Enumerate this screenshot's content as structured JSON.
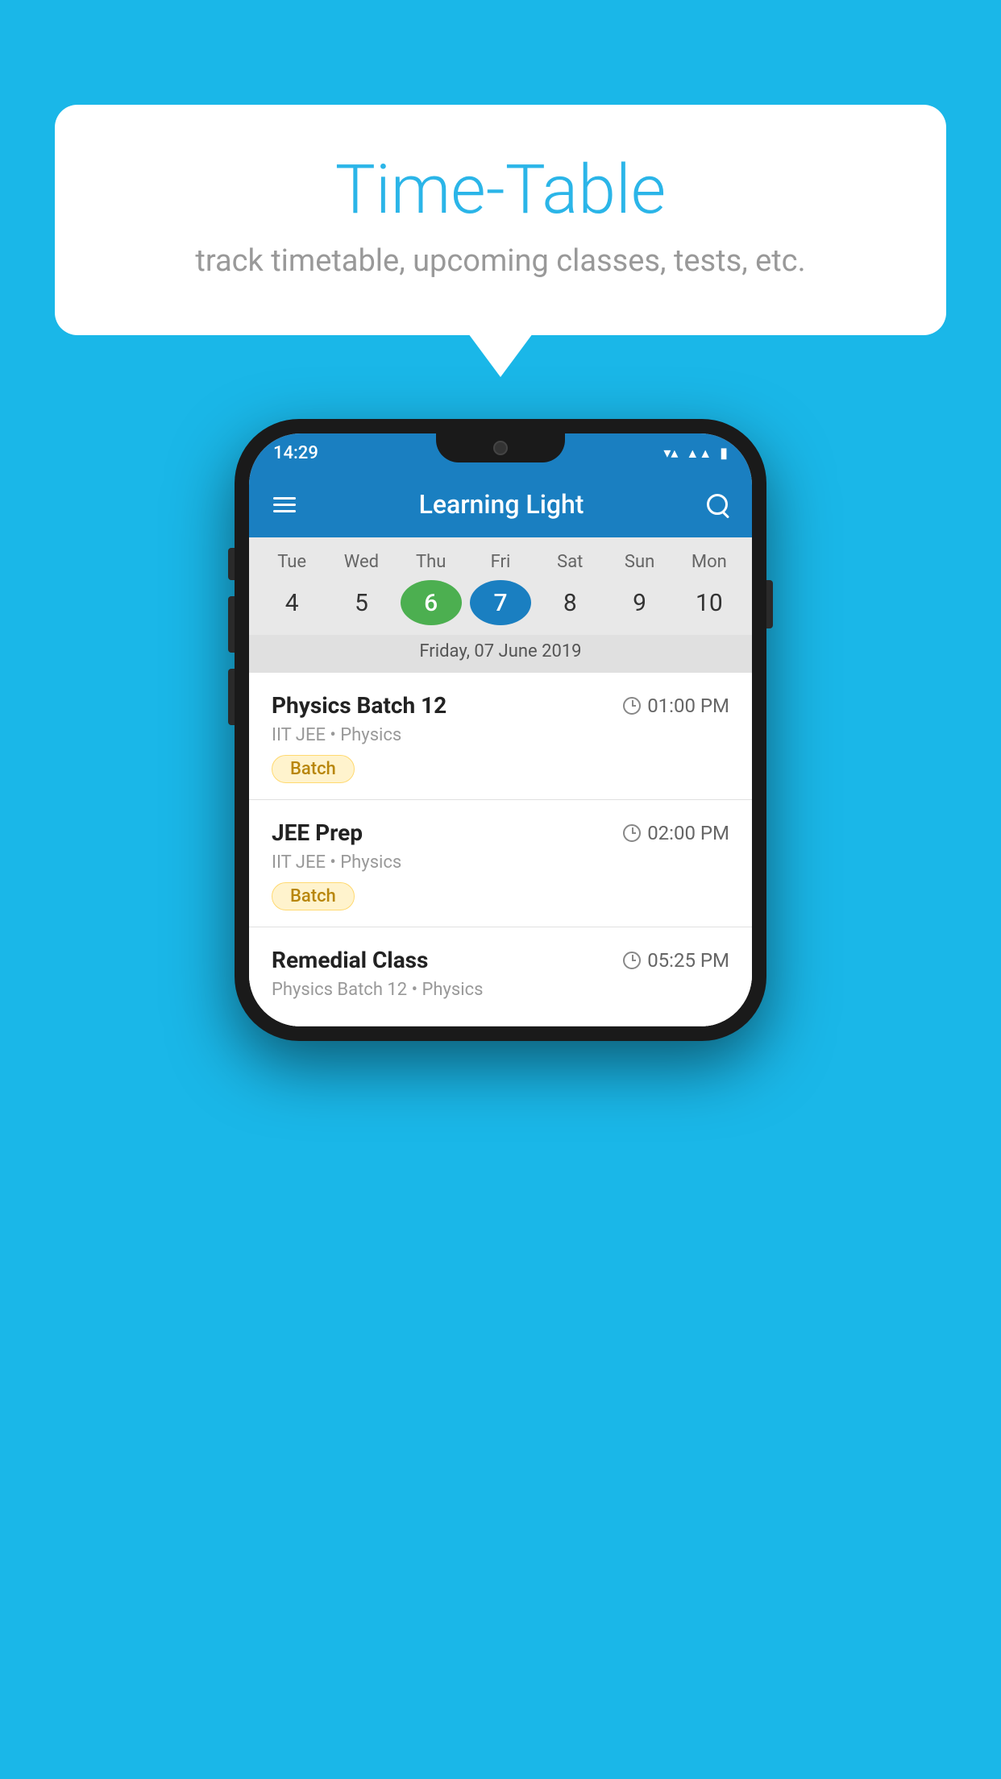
{
  "background_color": "#1ab7e8",
  "bubble": {
    "title": "Time-Table",
    "subtitle": "track timetable, upcoming classes, tests, etc."
  },
  "phone": {
    "status_bar": {
      "time": "14:29",
      "wifi": "▼▲",
      "battery": "▮"
    },
    "toolbar": {
      "title": "Learning Light"
    },
    "calendar": {
      "days": [
        {
          "name": "Tue",
          "num": "4"
        },
        {
          "name": "Wed",
          "num": "5"
        },
        {
          "name": "Thu",
          "num": "6",
          "state": "today"
        },
        {
          "name": "Fri",
          "num": "7",
          "state": "selected"
        },
        {
          "name": "Sat",
          "num": "8"
        },
        {
          "name": "Sun",
          "num": "9"
        },
        {
          "name": "Mon",
          "num": "10"
        }
      ],
      "selected_date": "Friday, 07 June 2019"
    },
    "schedule": [
      {
        "title": "Physics Batch 12",
        "time": "01:00 PM",
        "meta": "IIT JEE • Physics",
        "tag": "Batch"
      },
      {
        "title": "JEE Prep",
        "time": "02:00 PM",
        "meta": "IIT JEE • Physics",
        "tag": "Batch"
      },
      {
        "title": "Remedial Class",
        "time": "05:25 PM",
        "meta": "Physics Batch 12 • Physics",
        "tag": ""
      }
    ]
  }
}
